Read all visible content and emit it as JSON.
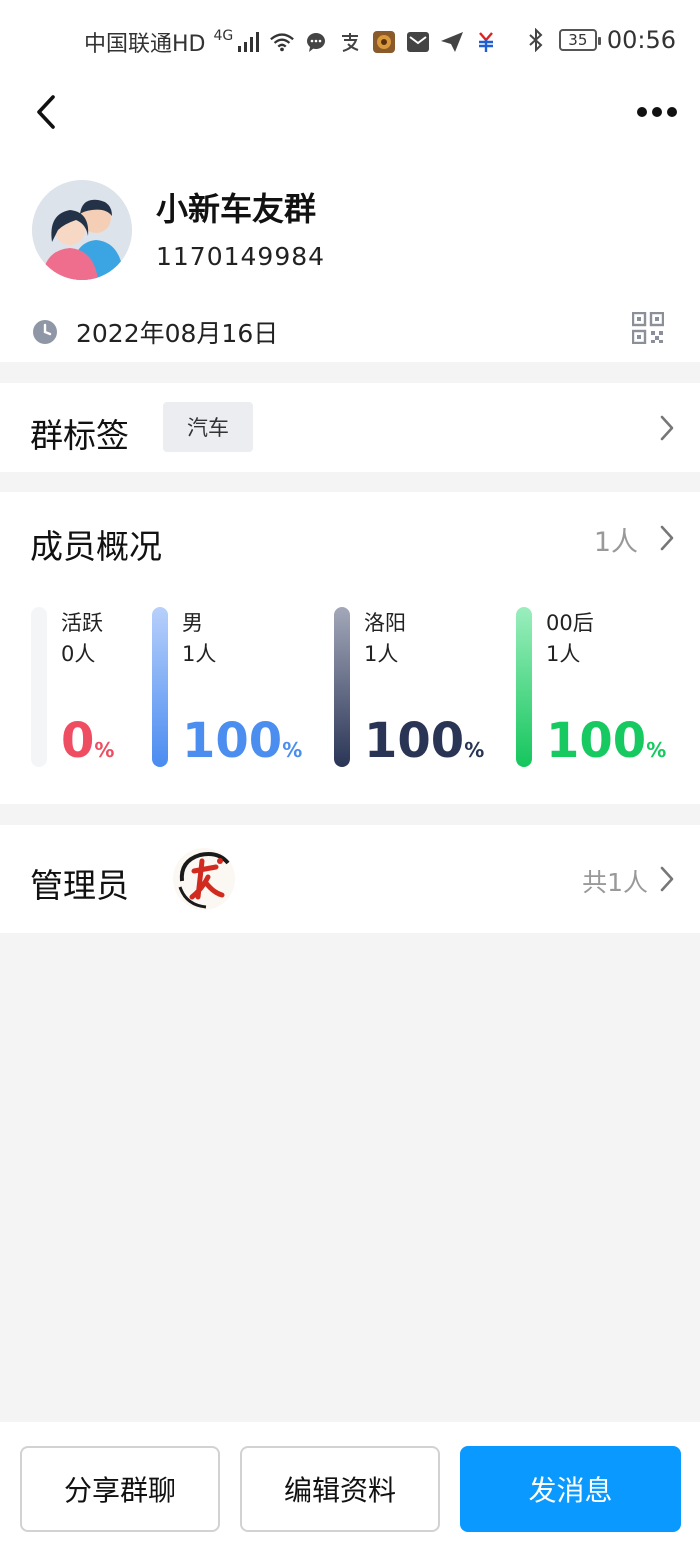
{
  "status_bar": {
    "carrier": "中国联通HD",
    "network": "4G",
    "battery": "35",
    "time": "00:56"
  },
  "group": {
    "name": "小新车友群",
    "id": "1170149984",
    "created_date": "2022年08月16日"
  },
  "tags_section": {
    "title": "群标签",
    "tags": [
      "汽车"
    ]
  },
  "members_section": {
    "title": "成员概况",
    "count_label": "1人",
    "stats": [
      {
        "label": "活跃",
        "count": "0人",
        "percent": "0",
        "unit": "%",
        "value": 0,
        "color": "#ef4d61",
        "bar_gradient": [
          "#f4f5f7",
          "#f4f5f7"
        ]
      },
      {
        "label": "男",
        "count": "1人",
        "percent": "100",
        "unit": "%",
        "value": 1,
        "color": "#4c8df0",
        "bar_gradient": [
          "#b8d0fb",
          "#4a8cf0"
        ]
      },
      {
        "label": "洛阳",
        "count": "1人",
        "percent": "100",
        "unit": "%",
        "value": 1,
        "color": "#2a3556",
        "bar_gradient": [
          "#a3a8b9",
          "#2a3556"
        ]
      },
      {
        "label": "00后",
        "count": "1人",
        "percent": "100",
        "unit": "%",
        "value": 1,
        "color": "#16c960",
        "bar_gradient": [
          "#9beebd",
          "#15c65d"
        ]
      }
    ]
  },
  "admin_section": {
    "title": "管理员",
    "count_label": "共1人"
  },
  "bottom_bar": {
    "share_label": "分享群聊",
    "edit_label": "编辑资料",
    "message_label": "发消息"
  },
  "colors": {
    "primary": "#0a99ff",
    "background": "#f4f4f4"
  }
}
